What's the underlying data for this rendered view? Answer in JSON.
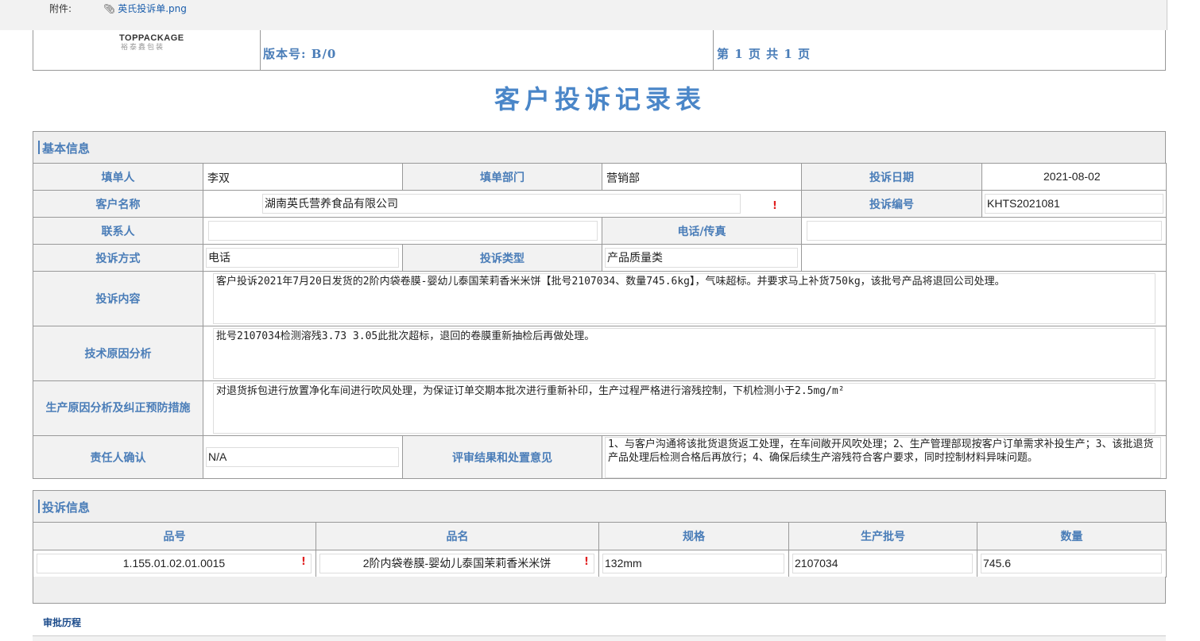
{
  "attachment": {
    "label": "附件:",
    "file_name": "英氏投诉单.png"
  },
  "header": {
    "logo_text": "TOPPACKAGE",
    "logo_cn": "裕泰鑫包装",
    "version": "版本号: B/0",
    "page": "第 1 页 共 1 页"
  },
  "title": "客户投诉记录表",
  "basic": {
    "section_title": "基本信息",
    "filler_label": "填单人",
    "filler": "李双",
    "dept_label": "填单部门",
    "dept": "营销部",
    "date_label": "投诉日期",
    "date": "2021-08-02",
    "customer_label": "客户名称",
    "customer": "湖南英氏营养食品有限公司",
    "complaint_no_label": "投诉编号",
    "complaint_no": "KHTS2021081",
    "contact_label": "联系人",
    "contact": "",
    "phone_label": "电话/传真",
    "phone": "",
    "method_label": "投诉方式",
    "method": "电话",
    "type_label": "投诉类型",
    "type": "产品质量类",
    "content_label": "投诉内容",
    "content": "客户投诉2021年7月20日发货的2阶内袋卷膜-婴幼儿泰国茉莉香米米饼【批号2107034、数量745.6kg】，气味超标。并要求马上补货750kg，该批号产品将退回公司处理。",
    "tech_label": "技术原因分析",
    "tech": "批号2107034检测溶残3.73  3.05此批次超标，退回的卷膜重新抽检后再做处理。",
    "prod_label": "生产原因分析及纠正预防措施",
    "prod": "对退货拆包进行放置净化车间进行吹风处理，为保证订单交期本批次进行重新补印，生产过程严格进行溶残控制，下机检测小于2.5mg/m²",
    "resp_label": "责任人确认",
    "resp": "N/A",
    "review_label": "评审结果和处置意见",
    "review": "1、与客户沟通将该批货退货返工处理，在车间敞开风吹处理；2、生产管理部现按客户订单需求补投生产；3、该批退货产品处理后检测合格后再放行；4、确保后续生产溶残符合客户要求，同时控制材料异味问题。"
  },
  "items": {
    "section_title": "投诉信息",
    "columns": [
      "品号",
      "品名",
      "规格",
      "生产批号",
      "数量"
    ],
    "rows": [
      {
        "code": "1.155.01.02.01.0015",
        "name": "2阶内袋卷膜-婴幼儿泰国茉莉香米米饼",
        "spec": "132mm",
        "batch": "2107034",
        "qty": "745.6"
      }
    ]
  },
  "required_mark": "!",
  "approval_history": "审批历程",
  "colors": {
    "label_blue": "#4a7db8",
    "title_blue": "#4a86c8",
    "required_red": "#e02020"
  }
}
